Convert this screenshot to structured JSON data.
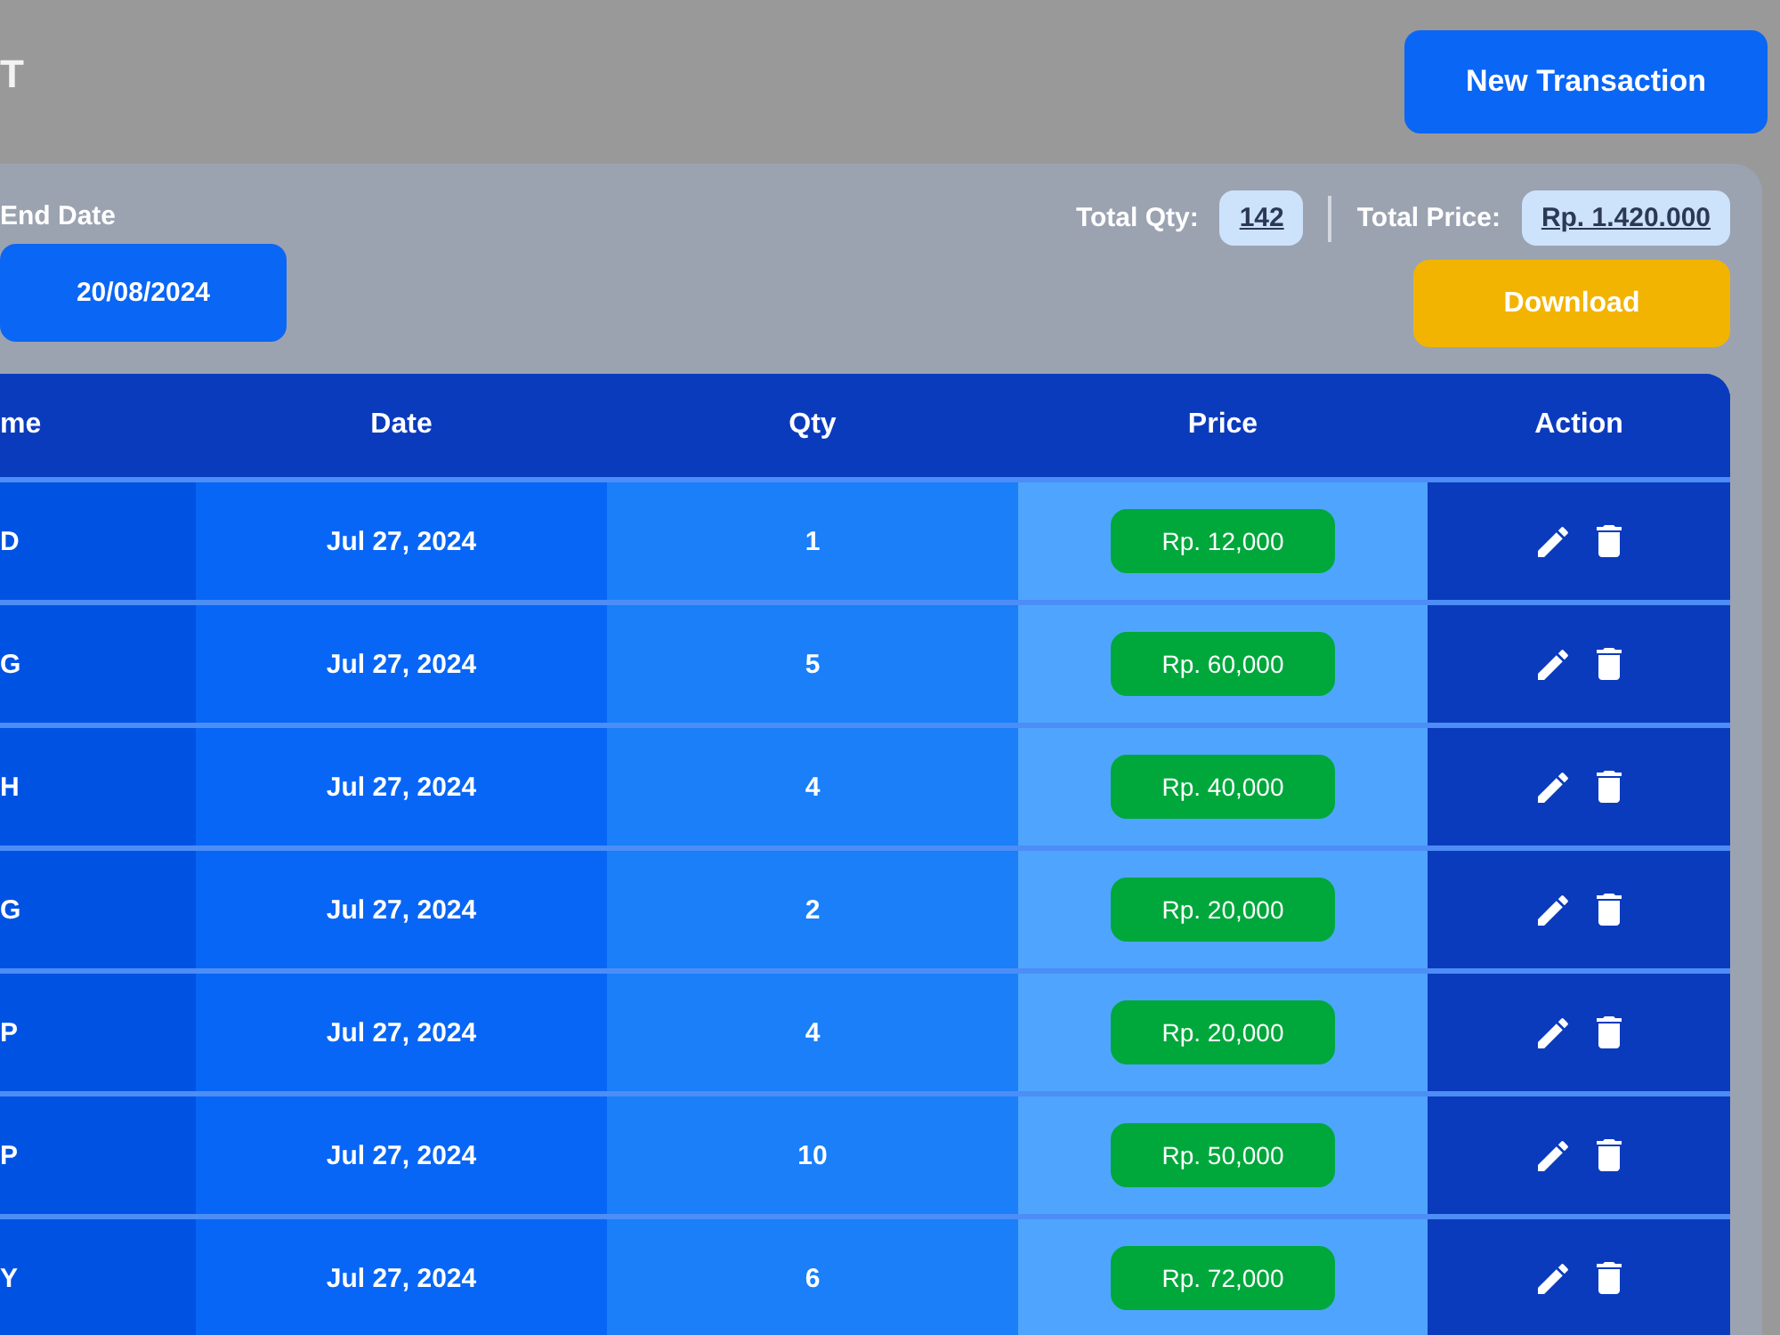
{
  "header": {
    "title": "T",
    "new_button": "New Transaction"
  },
  "filters": {
    "end_date": {
      "label": "End Date",
      "value": "20/08/2024"
    }
  },
  "totals": {
    "qty_label": "Total Qty:",
    "qty": "142",
    "price_label": "Total Price:",
    "price": "Rp. 1.420.000"
  },
  "download_button": "Download",
  "table": {
    "columns": [
      {
        "label": "me",
        "kind": "text"
      },
      {
        "label": "Date",
        "kind": "text"
      },
      {
        "label": "Qty",
        "kind": "text"
      },
      {
        "label": "Price",
        "kind": "badge"
      },
      {
        "label": "Action",
        "kind": "actions"
      }
    ],
    "rows": [
      {
        "cells": [
          "D",
          "Jul 27, 2024",
          "1",
          "Rp. 12,000"
        ]
      },
      {
        "cells": [
          "G",
          "Jul 27, 2024",
          "5",
          "Rp. 60,000"
        ]
      },
      {
        "cells": [
          "H",
          "Jul 27, 2024",
          "4",
          "Rp. 40,000"
        ]
      },
      {
        "cells": [
          "G",
          "Jul 27, 2024",
          "2",
          "Rp. 20,000"
        ]
      },
      {
        "cells": [
          "P",
          "Jul 27, 2024",
          "4",
          "Rp. 20,000"
        ]
      },
      {
        "cells": [
          "P",
          "Jul 27, 2024",
          "10",
          "Rp. 50,000"
        ]
      },
      {
        "cells": [
          "Y",
          "Jul 27, 2024",
          "6",
          "Rp. 72,000"
        ]
      }
    ]
  }
}
